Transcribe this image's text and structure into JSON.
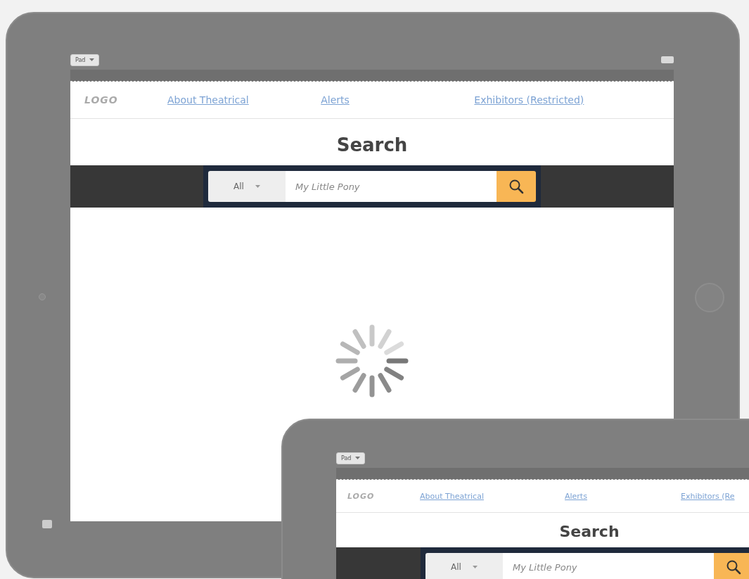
{
  "devices": [
    {
      "device_menu": "Pad",
      "nav": {
        "logo": "LOGO",
        "links": [
          "About Theatrical",
          "Alerts",
          "Exhibitors (Restricted)"
        ]
      },
      "heading": "Search",
      "search": {
        "scope": "All",
        "placeholder": "My Little Pony"
      },
      "loading": true
    },
    {
      "device_menu": "Pad",
      "nav": {
        "logo": "LOGO",
        "links": [
          "About Theatrical",
          "Alerts",
          "Exhibitors (Re"
        ]
      },
      "heading": "Search",
      "search": {
        "scope": "All",
        "placeholder": "My Little Pony"
      }
    }
  ]
}
